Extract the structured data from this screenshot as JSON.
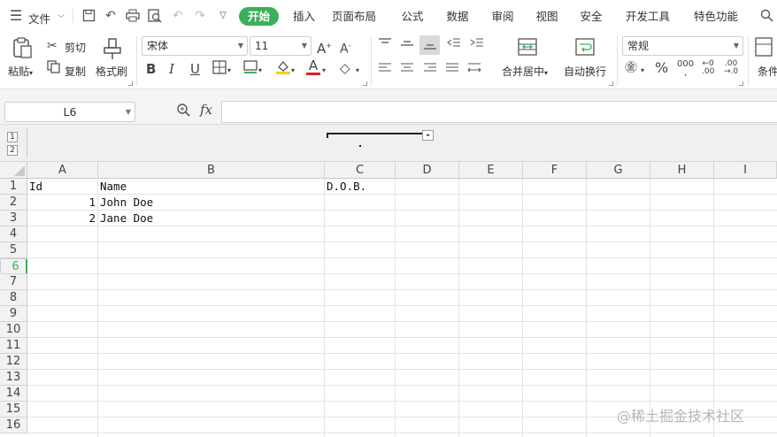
{
  "menu": {
    "file_label": "文件",
    "tabs": [
      "开始",
      "插入",
      "页面布局",
      "公式",
      "数据",
      "审阅",
      "视图",
      "安全",
      "开发工具",
      "特色功能"
    ],
    "active_tab_index": 0,
    "accent_color": "#3dae5a"
  },
  "ribbon": {
    "paste_label": "粘贴",
    "cut_label": "剪切",
    "copy_label": "复制",
    "format_painter_label": "格式刷",
    "font_name": "宋体",
    "font_size": "11",
    "merge_center_label": "合并居中",
    "wrap_text_label": "自动换行",
    "number_format": "常规",
    "conditional_label": "条件"
  },
  "formula_bar": {
    "name_box": "L6",
    "fx_label": "fx",
    "formula": ""
  },
  "outline": {
    "levels": [
      "1",
      "2"
    ],
    "collapse_button": "-"
  },
  "sheet": {
    "columns": [
      "A",
      "B",
      "C",
      "D",
      "E",
      "F",
      "G",
      "H",
      "I"
    ],
    "rows": [
      "1",
      "2",
      "3",
      "4",
      "5",
      "6",
      "7",
      "8",
      "9",
      "10",
      "11",
      "12",
      "13",
      "14",
      "15",
      "16"
    ],
    "selected_row": "6",
    "cells": {
      "A1": "Id",
      "B1": "Name",
      "C1": "D.O.B.",
      "A2": "1",
      "B2": "John Doe",
      "A3": "2",
      "B3": "Jane Doe"
    }
  },
  "watermark": "@稀土掘金技术社区"
}
